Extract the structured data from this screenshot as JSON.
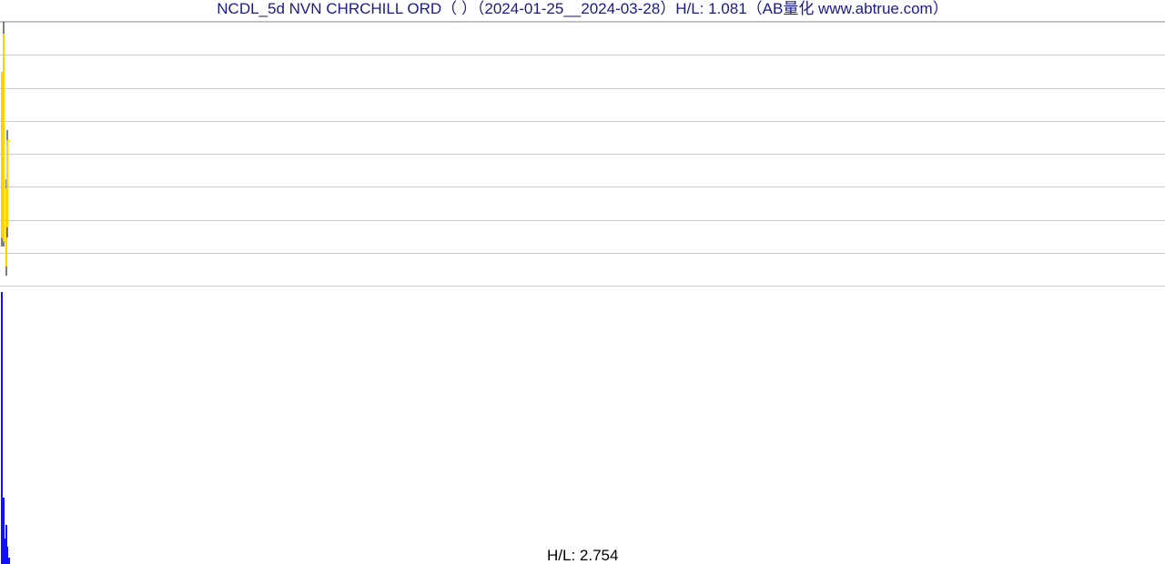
{
  "title": "NCDL_5d NVN CHRCHILL ORD（ ）（2024-01-25__2024-03-28）H/L: 1.081（AB量化  www.abtrue.com）",
  "volume_label": "H/L: 2.754",
  "chart_data": {
    "type": "bar",
    "title": "NCDL_5d NVN CHRCHILL ORD H/L 1.081",
    "xlabel": "",
    "ylabel": "",
    "x": [
      0,
      1,
      2,
      3,
      4,
      5,
      6,
      7,
      8
    ],
    "price": {
      "ylim": [
        16.8,
        18.16
      ],
      "grid_lines": 9,
      "candles": [
        {
          "o": 17.9,
          "h": 17.9,
          "l": 17.0,
          "c": 17.05,
          "color": "#ffd100"
        },
        {
          "o": 17.05,
          "h": 17.05,
          "l": 17.05,
          "c": 17.05,
          "color": "#ffd100"
        },
        {
          "o": 18.1,
          "h": 18.16,
          "l": 17.0,
          "c": 17.03,
          "color": "#ffd100"
        },
        {
          "o": 17.03,
          "h": 17.03,
          "l": 17.03,
          "c": 17.03,
          "color": "#ffd100"
        },
        {
          "o": 17.03,
          "h": 17.03,
          "l": 17.03,
          "c": 17.03,
          "color": "#ffd100"
        },
        {
          "o": 17.3,
          "h": 17.35,
          "l": 16.85,
          "c": 16.9,
          "color": "#ffd100"
        },
        {
          "o": 17.1,
          "h": 17.6,
          "l": 17.05,
          "c": 17.55,
          "color": "#ffd100"
        },
        {
          "o": 17.55,
          "h": 17.55,
          "l": 17.55,
          "c": 17.55,
          "color": "#ffd100"
        },
        {
          "o": 17.55,
          "h": 17.55,
          "l": 17.55,
          "c": 17.55,
          "color": "#ffd100"
        }
      ]
    },
    "volume": {
      "ylim": [
        0,
        2.754
      ],
      "bars": [
        {
          "v": 2.754,
          "color": "#1010ff"
        },
        {
          "v": 0.55,
          "color": "#1010ff"
        },
        {
          "v": 0.68,
          "color": "#1010ff"
        },
        {
          "v": 0.27,
          "color": "#1010ff"
        },
        {
          "v": 0.07,
          "color": "#1010ff"
        },
        {
          "v": 0.4,
          "color": "#1010ff"
        },
        {
          "v": 0.18,
          "color": "#1010ff"
        },
        {
          "v": 0.0,
          "color": "#1010ff"
        },
        {
          "v": 0.07,
          "color": "#1010ff"
        }
      ]
    }
  }
}
